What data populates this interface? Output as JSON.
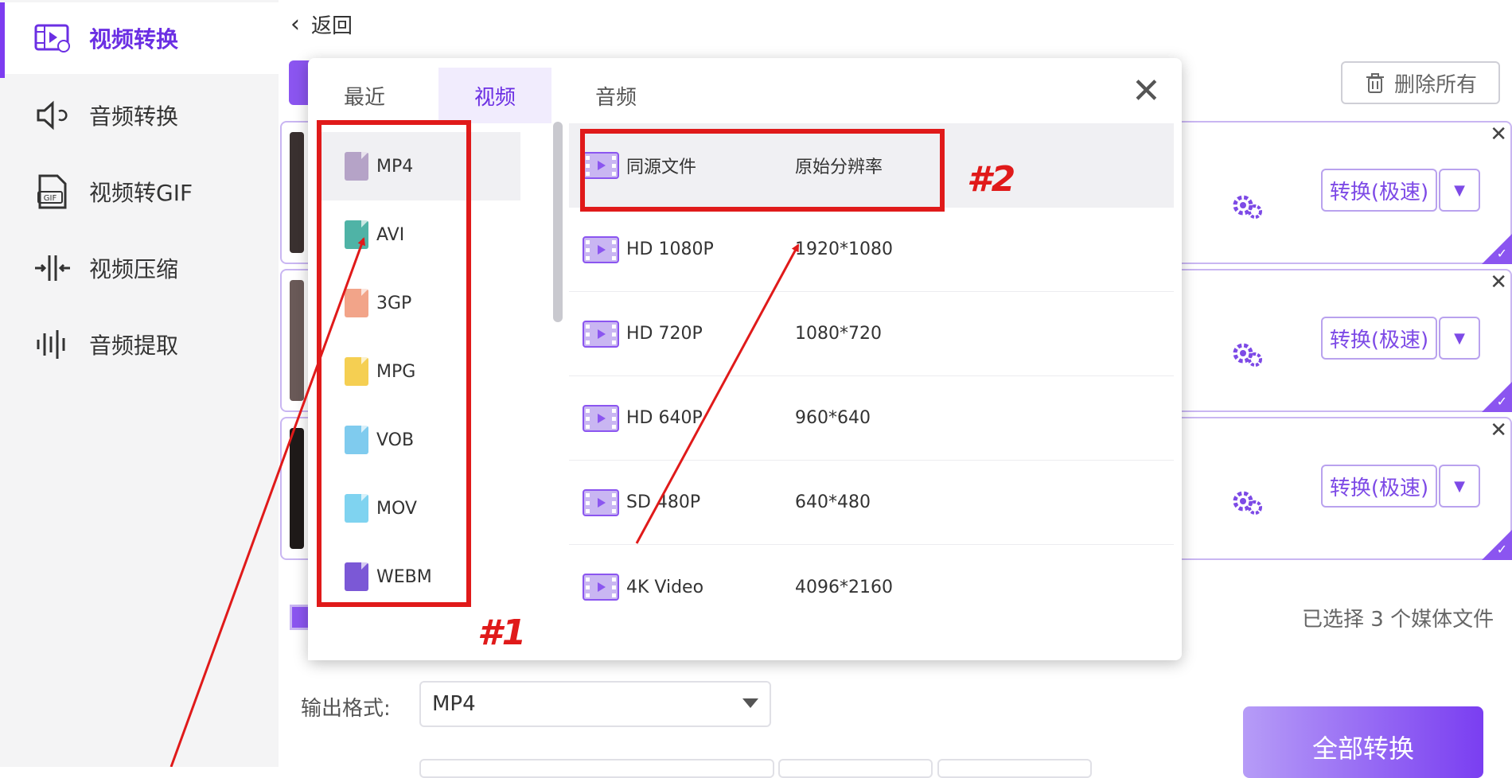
{
  "sidebar": {
    "items": [
      {
        "label": "视频转换",
        "icon": "video-convert-icon",
        "active": true
      },
      {
        "label": "音频转换",
        "icon": "speaker-icon",
        "active": false
      },
      {
        "label": "视频转GIF",
        "icon": "gif-file-icon",
        "active": false
      },
      {
        "label": "视频压缩",
        "icon": "compress-icon",
        "active": false
      },
      {
        "label": "音频提取",
        "icon": "audio-wave-icon",
        "active": false
      }
    ]
  },
  "header": {
    "back_label": "返回",
    "delete_all_label": "删除所有"
  },
  "tasks": [
    {
      "convert_label": "转换(极速)"
    },
    {
      "convert_label": "转换(极速)"
    },
    {
      "convert_label": "转换(极速)"
    }
  ],
  "footer": {
    "selected_text": "已选择 3 个媒体文件",
    "output_label": "输出格式:",
    "output_value": "MP4",
    "convert_all_label": "全部转换"
  },
  "modal": {
    "tabs": [
      {
        "label": "最近",
        "active": false
      },
      {
        "label": "视频",
        "active": true
      },
      {
        "label": "音频",
        "active": false
      }
    ],
    "formats": [
      {
        "label": "MP4",
        "color": "#b5a3c7",
        "active": true
      },
      {
        "label": "AVI",
        "color": "#4fb3a6",
        "active": false
      },
      {
        "label": "3GP",
        "color": "#f2a489",
        "active": false
      },
      {
        "label": "MPG",
        "color": "#f5cf52",
        "active": false
      },
      {
        "label": "VOB",
        "color": "#7fcbee",
        "active": false
      },
      {
        "label": "MOV",
        "color": "#7fd3f0",
        "active": false
      },
      {
        "label": "WEBM",
        "color": "#7b58d6",
        "active": false
      }
    ],
    "resolutions": [
      {
        "name": "同源文件",
        "value": "原始分辨率",
        "active": true
      },
      {
        "name": "HD 1080P",
        "value": "1920*1080",
        "active": false
      },
      {
        "name": "HD 720P",
        "value": "1080*720",
        "active": false
      },
      {
        "name": "HD 640P",
        "value": "960*640",
        "active": false
      },
      {
        "name": "SD 480P",
        "value": "640*480",
        "active": false
      },
      {
        "name": "4K Video",
        "value": "4096*2160",
        "active": false
      }
    ]
  },
  "annotations": {
    "label1": "#1",
    "label2": "#2",
    "color": "#e01a1a"
  },
  "colors": {
    "accent": "#7d3cf0",
    "annotation": "#e01a1a"
  }
}
